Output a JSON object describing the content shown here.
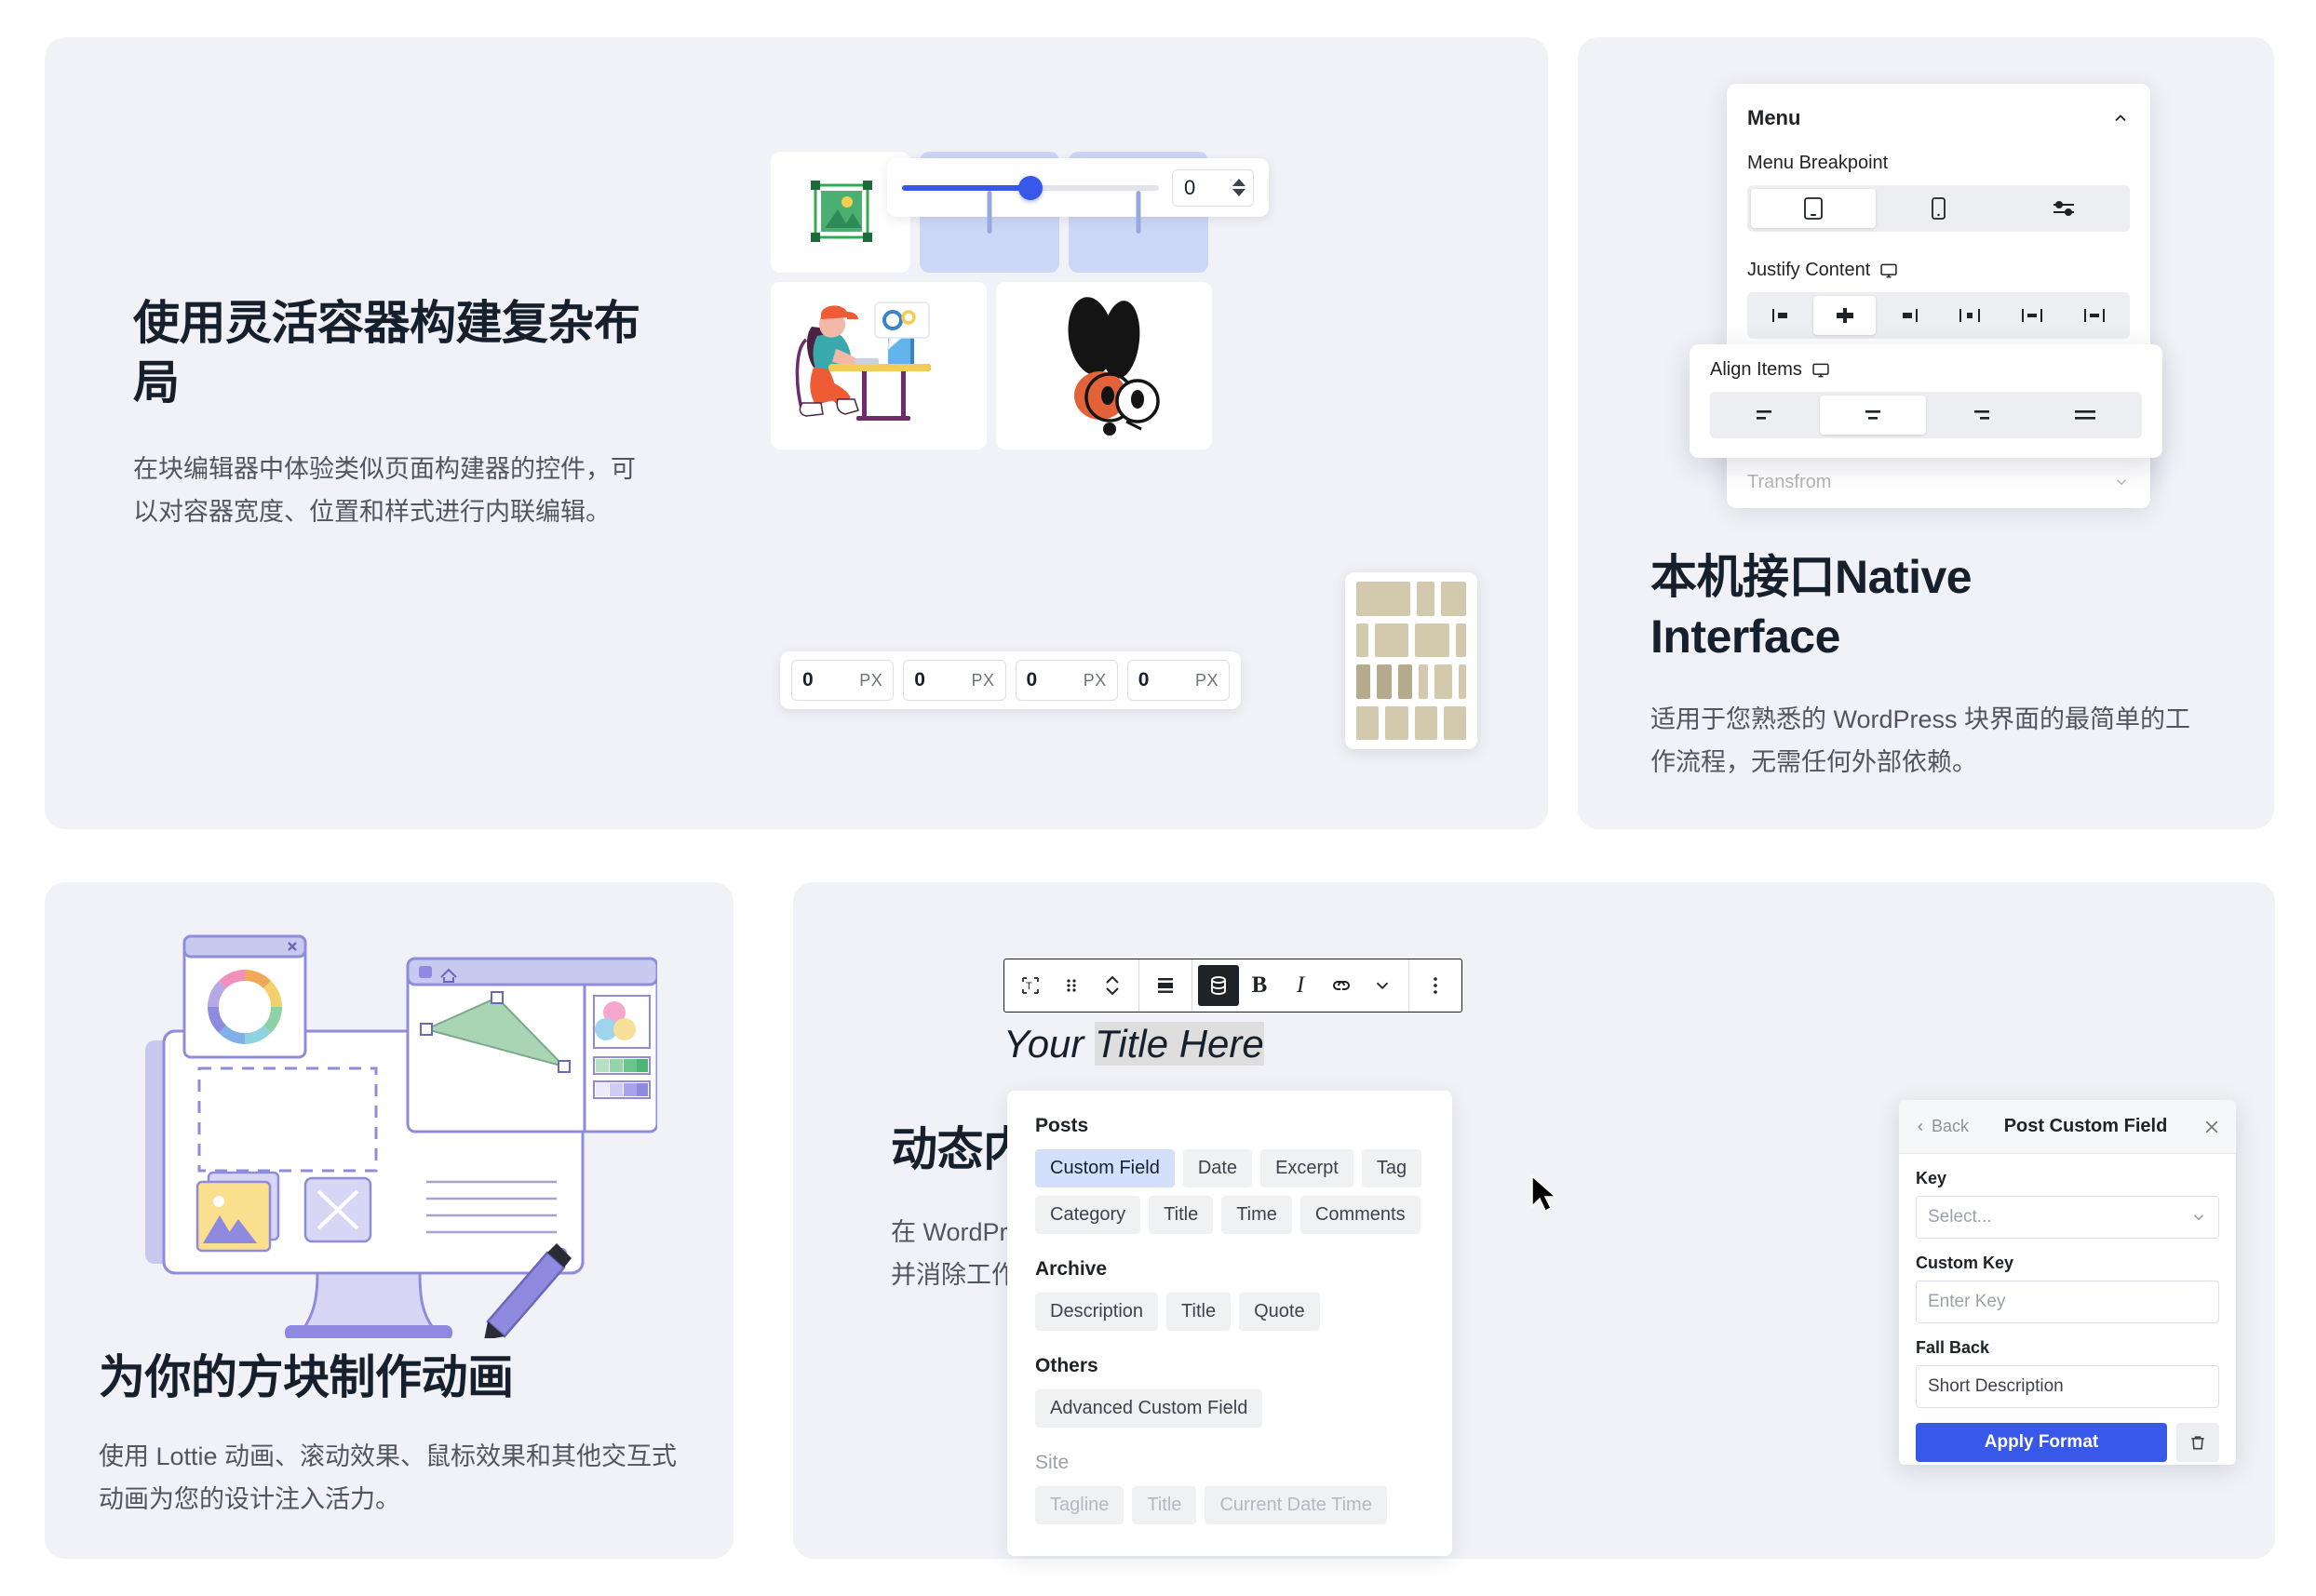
{
  "cards": {
    "flex": {
      "title": "使用灵活容器构建复杂布局",
      "desc": "在块编辑器中体验类似页面构建器的控件，可以对容器宽度、位置和样式进行内联编辑。",
      "slider": {
        "value": "0"
      },
      "spacing_fields": [
        {
          "value": "0",
          "unit": "PX"
        },
        {
          "value": "0",
          "unit": "PX"
        },
        {
          "value": "0",
          "unit": "PX"
        },
        {
          "value": "0",
          "unit": "PX"
        }
      ]
    },
    "native": {
      "title_line1": "本机接口Native",
      "title_line2": "Interface",
      "desc": "适用于您熟悉的 WordPress 块界面的最简单的工作流程，无需任何外部依赖。",
      "panel": {
        "heading": "Menu",
        "breakpoint_label": "Menu Breakpoint",
        "breakpoint_options": [
          "tablet-icon",
          "mobile-icon",
          "sliders-icon"
        ],
        "breakpoint_selected": 0,
        "justify_label": "Justify Content",
        "justify_device": "desktop-icon",
        "justify_selected": 1,
        "align_label": "Align Items",
        "align_device": "desktop-icon",
        "align_selected": 1,
        "transform_label": "Transfrom"
      }
    },
    "animate": {
      "title": "为你的方块制作动画",
      "desc": "使用 Lottie 动画、滚动效果、鼠标效果和其他交互式动画为您的设计注入活力。"
    },
    "dynamic": {
      "title": "动态内容",
      "desc": "在 WordPress 网站编辑器中设计动态模板并消除工作流程中的重复任务。",
      "editor": {
        "title_prefix": "Your ",
        "title_highlight": "Title Here",
        "toolbar_icons": [
          "transform-block-icon",
          "drag-handle-icon",
          "move-updown-icon",
          "align-icon",
          "dynamic-data-icon",
          "bold-icon",
          "italic-icon",
          "link-icon",
          "chevron-down-icon",
          "more-options-icon"
        ]
      },
      "fields_panel": {
        "groups": [
          {
            "heading": "Posts",
            "rows": [
              [
                "Custom Field",
                "Date",
                "Excerpt",
                "Tag"
              ],
              [
                "Category",
                "Title",
                "Time",
                "Comments"
              ]
            ],
            "selected": "Custom Field"
          },
          {
            "heading": "Archive",
            "rows": [
              [
                "Description",
                "Title",
                "Quote"
              ]
            ]
          },
          {
            "heading": "Others",
            "rows": [
              [
                "Advanced Custom Field"
              ]
            ]
          },
          {
            "heading": "Site",
            "rows": [
              [
                "Tagline",
                "Title",
                "Current Date Time"
              ]
            ],
            "muted": true
          }
        ]
      },
      "custom_field_panel": {
        "back_label": "Back",
        "title": "Post Custom Field",
        "close_icon": "close-icon",
        "key_label": "Key",
        "key_value": "Select...",
        "custom_key_label": "Custom Key",
        "custom_key_placeholder": "Enter Key",
        "fall_back_label": "Fall Back",
        "fall_back_value": "Short Description",
        "apply_label": "Apply Format",
        "delete_icon": "trash-icon"
      }
    }
  },
  "colors": {
    "card_bg": "#f1f2f7",
    "accent_blue": "#3858e9",
    "chip_selected": "#d4e0fb",
    "title_dark": "#16202c"
  }
}
